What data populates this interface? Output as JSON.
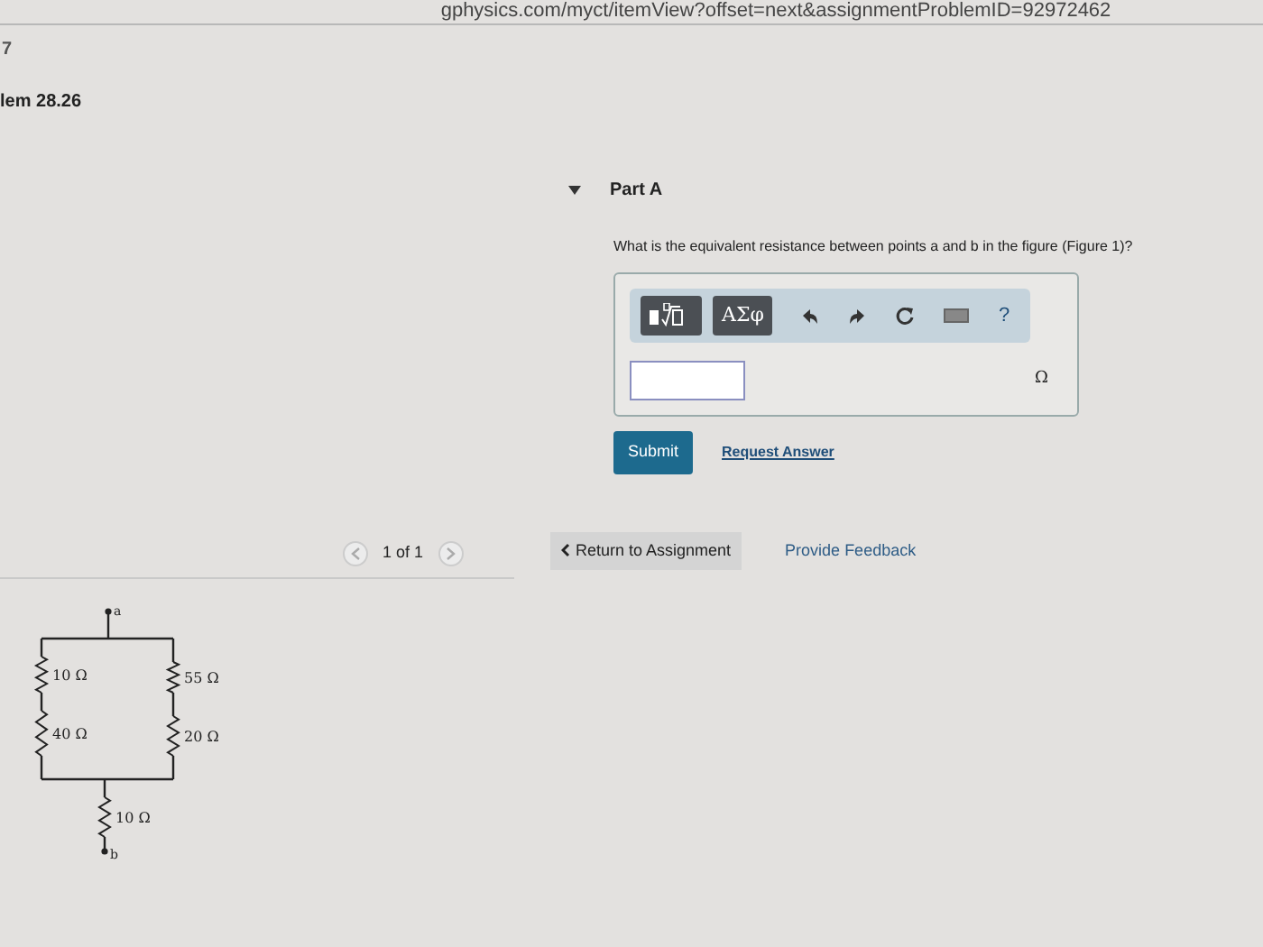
{
  "browser": {
    "url": "gphysics.com/myct/itemView?offset=next&assignmentProblemID=92972462"
  },
  "header": {
    "number": "7",
    "title": "lem 28.26"
  },
  "figure_pager": {
    "label": "1 of 1"
  },
  "figure": {
    "terminals": [
      {
        "label": "a"
      },
      {
        "label": "b"
      }
    ],
    "resistors": [
      {
        "label": "10 Ω"
      },
      {
        "label": "40 Ω"
      },
      {
        "label": "55 Ω"
      },
      {
        "label": "20 Ω"
      },
      {
        "label": "10 Ω"
      }
    ]
  },
  "part": {
    "title": "Part A",
    "expanded": true,
    "question": "What is the equivalent resistance between points a and b in the figure (",
    "figure_link": "Figure 1",
    "question_end": ")?",
    "toolbar": [
      {
        "kind": "template"
      },
      {
        "kind": "symbols",
        "label": "ΑΣφ"
      },
      {
        "kind": "undo"
      },
      {
        "kind": "redo"
      },
      {
        "kind": "reset"
      },
      {
        "kind": "keyboard"
      },
      {
        "kind": "help",
        "label": "?"
      }
    ],
    "unit": "Ω",
    "submit": "Submit",
    "request": "Request Answer"
  },
  "footer": {
    "return": "Return to Assignment",
    "feedback": "Provide Feedback"
  }
}
